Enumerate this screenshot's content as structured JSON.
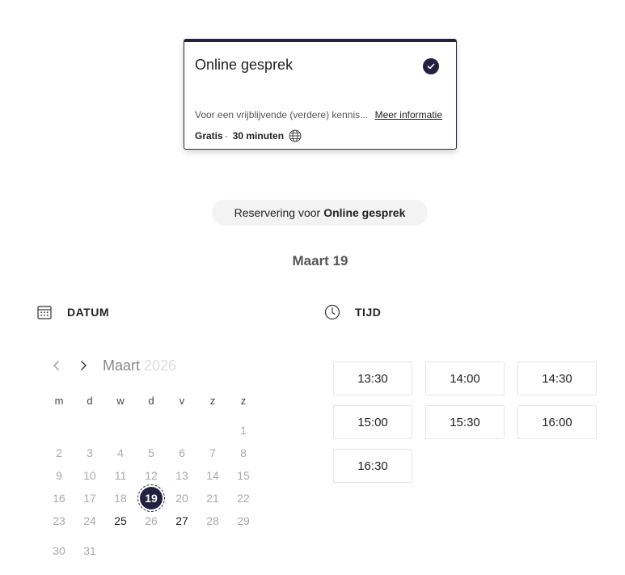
{
  "service": {
    "title": "Online gesprek",
    "description": "Voor een vrijblijvende (verdere) kennis...",
    "more_link": "Meer informatie",
    "price": "Gratis",
    "separator": "·",
    "duration": "30 minuten",
    "selected": true
  },
  "reservation": {
    "prefix": "Reservering voor",
    "service_name": "Online gesprek"
  },
  "selected_date_label": "Maart 19",
  "date_section": {
    "title": "DATUM",
    "icon": "calendar-icon"
  },
  "time_section": {
    "title": "TIJD",
    "icon": "clock-icon"
  },
  "calendar": {
    "month": "Maart",
    "year": "2026",
    "weekdays": [
      "m",
      "d",
      "w",
      "d",
      "v",
      "z",
      "z"
    ],
    "weeks": [
      [
        "",
        "",
        "",
        "",
        "",
        "",
        "1"
      ],
      [
        "2",
        "3",
        "4",
        "5",
        "6",
        "7",
        "8"
      ],
      [
        "9",
        "10",
        "11",
        "12",
        "13",
        "14",
        "15"
      ],
      [
        "16",
        "17",
        "18",
        "19",
        "20",
        "21",
        "22"
      ],
      [
        "23",
        "24",
        "25",
        "26",
        "27",
        "28",
        "29"
      ],
      [
        "30",
        "31",
        "",
        "",
        "",
        "",
        ""
      ]
    ],
    "available_days": [
      "19",
      "25",
      "27"
    ],
    "selected_day": "19"
  },
  "time_slots": [
    "13:30",
    "14:00",
    "14:30",
    "15:00",
    "15:30",
    "16:00",
    "16:30"
  ],
  "colors": {
    "accent": "#23213f",
    "pill_bg": "#f3f3f3",
    "muted_text": "#aaaaaa"
  }
}
